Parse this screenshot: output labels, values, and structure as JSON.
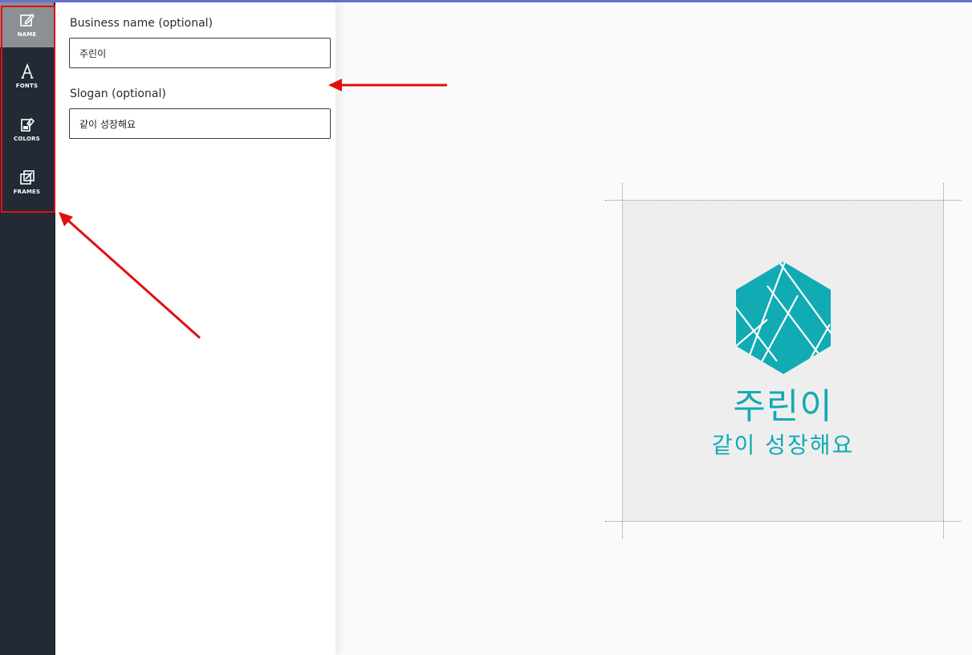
{
  "sidebar": {
    "items": [
      {
        "label": "NAME",
        "icon": "edit-icon",
        "active": true
      },
      {
        "label": "FONTS",
        "icon": "font-icon",
        "active": false
      },
      {
        "label": "COLORS",
        "icon": "paint-bucket-icon",
        "active": false
      },
      {
        "label": "FRAMES",
        "icon": "frame-icon",
        "active": false
      }
    ]
  },
  "panel": {
    "business_name": {
      "label": "Business name (optional)",
      "value": "주린이"
    },
    "slogan": {
      "label": "Slogan (optional)",
      "value": "같이 성장해요"
    }
  },
  "preview": {
    "name": "주린이",
    "slogan": "같이 성장해요",
    "logo_icon": "hexagon-logo-icon"
  },
  "colors": {
    "sidebar_bg": "#212a35",
    "accent_teal": "#11abb4",
    "annotation_red": "#e01010"
  }
}
